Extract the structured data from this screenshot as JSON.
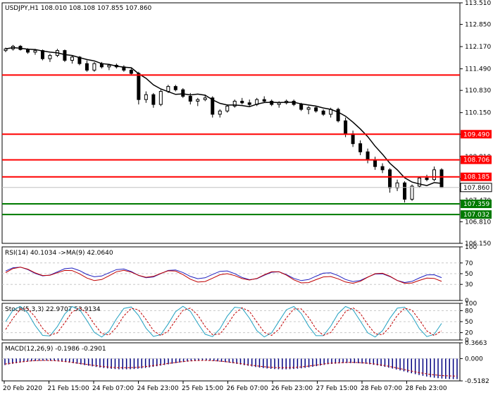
{
  "chart_data": [
    {
      "type": "candlestick",
      "title": "USDJPY,H1  108.010 108.108 107.855 107.860",
      "y_ticks": [
        "113.510",
        "112.850",
        "112.170",
        "111.490",
        "110.830",
        "110.150",
        "109.490",
        "108.810",
        "108.130",
        "107.470",
        "106.810",
        "106.150"
      ],
      "ylim": [
        106.15,
        113.51
      ],
      "last_price": "107.860",
      "candles_approx": [
        [
          112.05,
          112.14,
          112.0,
          112.1
        ],
        [
          112.1,
          112.22,
          112.05,
          112.18
        ],
        [
          112.18,
          112.22,
          112.05,
          112.08
        ],
        [
          112.08,
          112.12,
          111.95,
          112.0
        ],
        [
          112.0,
          112.1,
          111.92,
          112.05
        ],
        [
          112.05,
          112.08,
          111.75,
          111.8
        ],
        [
          111.8,
          111.95,
          111.7,
          111.9
        ],
        [
          111.9,
          112.1,
          111.85,
          112.05
        ],
        [
          112.05,
          112.08,
          111.7,
          111.75
        ],
        [
          111.75,
          111.9,
          111.65,
          111.85
        ],
        [
          111.85,
          111.88,
          111.6,
          111.65
        ],
        [
          111.65,
          111.75,
          111.4,
          111.45
        ],
        [
          111.45,
          111.7,
          111.4,
          111.65
        ],
        [
          111.65,
          111.7,
          111.5,
          111.55
        ],
        [
          111.55,
          111.62,
          111.45,
          111.6
        ],
        [
          111.6,
          111.65,
          111.5,
          111.55
        ],
        [
          111.55,
          111.6,
          111.4,
          111.45
        ],
        [
          111.45,
          111.5,
          111.3,
          111.35
        ],
        [
          111.35,
          111.4,
          110.4,
          110.55
        ],
        [
          110.55,
          110.8,
          110.45,
          110.7
        ],
        [
          110.7,
          110.75,
          110.3,
          110.4
        ],
        [
          110.4,
          110.85,
          110.35,
          110.8
        ],
        [
          110.8,
          111.0,
          110.75,
          110.95
        ],
        [
          110.95,
          111.0,
          110.8,
          110.85
        ],
        [
          110.85,
          110.9,
          110.6,
          110.65
        ],
        [
          110.65,
          110.75,
          110.4,
          110.5
        ],
        [
          110.5,
          110.6,
          110.35,
          110.55
        ],
        [
          110.55,
          110.7,
          110.5,
          110.6
        ],
        [
          110.6,
          110.65,
          110.0,
          110.1
        ],
        [
          110.1,
          110.25,
          110.0,
          110.2
        ],
        [
          110.2,
          110.4,
          110.15,
          110.35
        ],
        [
          110.35,
          110.55,
          110.3,
          110.5
        ],
        [
          110.5,
          110.6,
          110.4,
          110.45
        ],
        [
          110.45,
          110.55,
          110.35,
          110.4
        ],
        [
          110.4,
          110.6,
          110.35,
          110.55
        ],
        [
          110.55,
          110.65,
          110.45,
          110.5
        ],
        [
          110.5,
          110.55,
          110.35,
          110.4
        ],
        [
          110.4,
          110.5,
          110.3,
          110.45
        ],
        [
          110.45,
          110.55,
          110.4,
          110.5
        ],
        [
          110.5,
          110.55,
          110.35,
          110.4
        ],
        [
          110.4,
          110.45,
          110.2,
          110.25
        ],
        [
          110.25,
          110.35,
          110.1,
          110.3
        ],
        [
          110.3,
          110.35,
          110.15,
          110.2
        ],
        [
          110.2,
          110.25,
          110.05,
          110.1
        ],
        [
          110.1,
          110.3,
          110.0,
          110.25
        ],
        [
          110.25,
          110.3,
          109.85,
          109.9
        ],
        [
          109.9,
          110.0,
          109.4,
          109.5
        ],
        [
          109.5,
          109.6,
          109.1,
          109.2
        ],
        [
          109.2,
          109.3,
          108.85,
          108.95
        ],
        [
          108.95,
          109.05,
          108.6,
          108.7
        ],
        [
          108.7,
          108.8,
          108.4,
          108.5
        ],
        [
          108.5,
          108.6,
          108.3,
          108.4
        ],
        [
          108.4,
          108.45,
          107.7,
          107.85
        ],
        [
          107.85,
          108.1,
          107.75,
          108.0
        ],
        [
          108.0,
          108.05,
          107.4,
          107.5
        ],
        [
          107.5,
          107.95,
          107.45,
          107.9
        ],
        [
          107.9,
          108.2,
          107.85,
          108.15
        ],
        [
          108.15,
          108.25,
          108.05,
          108.1
        ],
        [
          108.1,
          108.5,
          108.05,
          108.4
        ],
        [
          108.4,
          108.45,
          107.85,
          107.86
        ]
      ]
    },
    {
      "type": "line",
      "title": "RSI(14) 40.1034  ->MA(9) 42.0640",
      "y_ticks": [
        "100",
        "70",
        "50",
        "30",
        "0"
      ],
      "ylim": [
        0,
        100
      ]
    },
    {
      "type": "line",
      "title": "Stoch(5,3,3) 22.9707 53.9134",
      "y_ticks": [
        "100",
        "80",
        "50",
        "20",
        "0"
      ],
      "ylim": [
        0,
        100
      ]
    },
    {
      "type": "bar",
      "title": "MACD(12,26,9) -0.1986 -0.2901",
      "y_ticks": [
        "0.3663",
        "0.000",
        "-0.5182"
      ],
      "ylim": [
        -0.5182,
        0.3663
      ]
    }
  ],
  "levels": [
    {
      "label": "109.490",
      "value": 109.49,
      "color": "#ff0000"
    },
    {
      "label": "108.706",
      "value": 108.706,
      "color": "#ff0000"
    },
    {
      "label": "108.185",
      "value": 108.185,
      "color": "#ff0000"
    },
    {
      "label": "107.359",
      "value": 107.359,
      "color": "#007a00"
    },
    {
      "label": "107.032",
      "value": 107.032,
      "color": "#007a00"
    }
  ],
  "top_line_value": 111.3,
  "x_labels": [
    "20 Feb 2020",
    "21 Feb 15:00",
    "24 Feb 07:00",
    "24 Feb 23:00",
    "25 Feb 15:00",
    "26 Feb 07:00",
    "26 Feb 23:00",
    "27 Feb 15:00",
    "28 Feb 07:00",
    "28 Feb 23:00"
  ],
  "colors": {
    "grid": "#c8c8c8",
    "frame": "#000000",
    "ma": "#000000",
    "rsi": "#2020c0",
    "rsi_ma": "#c00000",
    "stoch_k": "#20a0c0",
    "stoch_d": "#c00000",
    "macd": "#000080",
    "signal": "#c00000"
  }
}
